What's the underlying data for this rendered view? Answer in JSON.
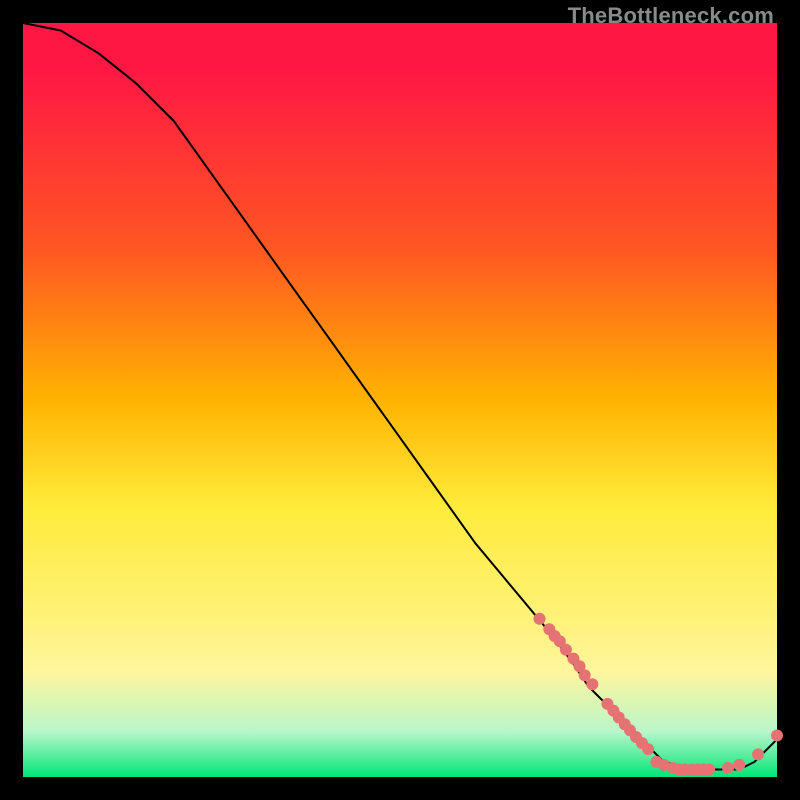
{
  "watermark": "TheBottleneck.com",
  "chart_data": {
    "type": "line",
    "title": "",
    "xlabel": "",
    "ylabel": "",
    "xlim": [
      0,
      100
    ],
    "ylim": [
      0,
      100
    ],
    "grid": false,
    "legend": false,
    "series": [
      {
        "name": "bottleneck-curve",
        "x": [
          0,
          5,
          10,
          15,
          20,
          25,
          30,
          35,
          40,
          45,
          50,
          55,
          60,
          65,
          70,
          73,
          75,
          77,
          79,
          81,
          83,
          84,
          85,
          87,
          89,
          91,
          93,
          95,
          97,
          100
        ],
        "y": [
          100,
          99,
          96,
          92,
          87,
          80,
          73,
          66,
          59,
          52,
          45,
          38,
          31,
          25,
          19,
          15,
          12,
          10,
          8,
          6,
          4,
          3,
          2,
          1.5,
          1,
          1,
          1,
          1,
          2,
          5
        ]
      }
    ],
    "clusters": [
      {
        "name": "upper-cluster",
        "points_xy": [
          [
            68.5,
            21.0
          ],
          [
            69.8,
            19.6
          ],
          [
            70.5,
            18.7
          ],
          [
            71.2,
            18.0
          ],
          [
            72.0,
            16.9
          ],
          [
            73.0,
            15.7
          ],
          [
            73.8,
            14.7
          ],
          [
            74.5,
            13.5
          ],
          [
            75.5,
            12.3
          ]
        ]
      },
      {
        "name": "mid-cluster",
        "points_xy": [
          [
            77.5,
            9.7
          ],
          [
            78.3,
            8.8
          ],
          [
            79.0,
            7.9
          ],
          [
            79.8,
            7.0
          ],
          [
            80.5,
            6.2
          ],
          [
            81.3,
            5.3
          ],
          [
            82.1,
            4.5
          ],
          [
            82.9,
            3.7
          ]
        ]
      },
      {
        "name": "bottom-cluster",
        "points_xy": [
          [
            84.0,
            2.0
          ],
          [
            85.0,
            1.6
          ],
          [
            86.2,
            1.2
          ],
          [
            87.0,
            1.0
          ],
          [
            87.8,
            1.0
          ],
          [
            88.7,
            1.0
          ],
          [
            89.5,
            1.0
          ],
          [
            90.3,
            1.0
          ],
          [
            91.0,
            1.0
          ],
          [
            93.5,
            1.2
          ],
          [
            95.0,
            1.6
          ],
          [
            97.5,
            3.0
          ],
          [
            100.0,
            5.5
          ]
        ]
      }
    ],
    "dot_color": "#e57373",
    "background_gradient": [
      "#ff1744",
      "#ff5722",
      "#ffb300",
      "#ffeb3b",
      "#fff59d",
      "#00e676"
    ]
  }
}
